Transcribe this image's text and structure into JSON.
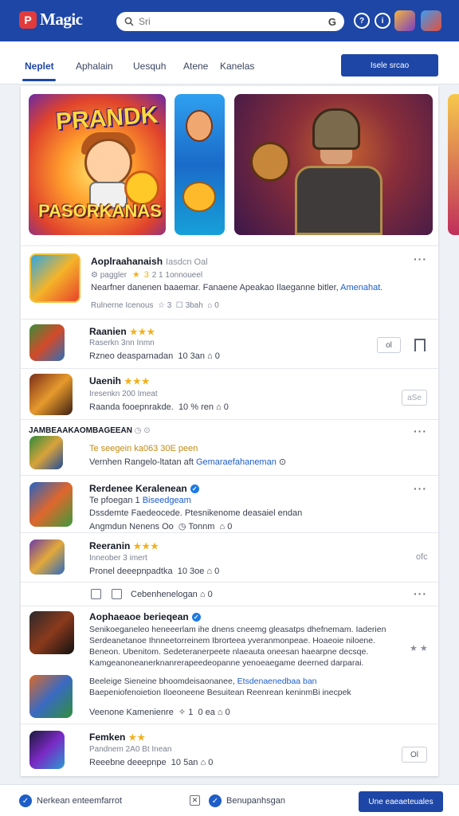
{
  "app": {
    "logo_mark": "P",
    "title": "Magic"
  },
  "search": {
    "placeholder": "Sri",
    "lens_label": "G"
  },
  "header_icons": [
    "help-icon",
    "info-icon",
    "avatar",
    "avatar"
  ],
  "tabs": [
    {
      "label": "Neplet",
      "active": true
    },
    {
      "label": "Aphalain",
      "active": false
    },
    {
      "label": "Uesquh",
      "active": false
    },
    {
      "label": "Atene",
      "active": false
    },
    {
      "label": "Kanelas",
      "active": false
    }
  ],
  "primary_action": "Isele srcao",
  "banners": [
    {
      "title": "PRANDK",
      "subtitle": "PASORKANAS"
    },
    {
      "title": ""
    },
    {
      "title": ""
    },
    {
      "title": ""
    }
  ],
  "featured": {
    "title": "Aoplraahanaish",
    "subtitle": "Iasdcn Oal",
    "meta": "paggler",
    "rating_text": "2 1 1onnoueel",
    "description": "Nearfner danenen baaemar. Fanaene Apeakao Ilaeganne bitler,",
    "description_link": "Amenahat.",
    "stats": [
      "Rulnerne Icenous",
      "3bah",
      "0"
    ]
  },
  "rows": [
    {
      "title": "Raanien",
      "stars": "★★★",
      "line1": "Raserkn 3nn Inmn",
      "line2": "Rzneo deasparnadan",
      "count": "10 3an",
      "action": "ol"
    },
    {
      "title": "Uaenih",
      "stars": "★★★",
      "line1": "Iresenkn 200 Imeat",
      "line2": "Raanda fooepnrakde.",
      "count": "10 % ren",
      "action": "aSe"
    },
    {
      "title": "JAMBEAAKAOMBAGEEAN",
      "stars": "",
      "line1": "Te seegein ka063 30E peen",
      "line2": "Vernhen Rangelo-ltatan aft",
      "line2_link": "Gemaraefahaneman",
      "count": "",
      "action": ""
    },
    {
      "title": "Rerdenee Keralenean",
      "stars": "",
      "verified": true,
      "line1": "Te pfoegan 1",
      "line1_link": "Biseedgeam",
      "line2": "Dssdemte Faedeocede. Ptesnikenome deasaiel endan",
      "line3": "Angmdun Nenens Oo",
      "count": "Tonnm",
      "action": ""
    },
    {
      "title": "Reeranin",
      "stars": "★★★",
      "line1": "Inneober 3 imert",
      "line2": "Pronel deeepnpadtka",
      "count": "10 3oe",
      "action": "ofc"
    }
  ],
  "toolbar_row": {
    "label": "Cebenhenelogan",
    "count": "0"
  },
  "long_row": {
    "title": "Aophaeaoe berieqean",
    "verified": true,
    "para1": [
      "Senikoeganeleo heneeerlam ihe dnens cneemg gleasatps dhefnemam. Iaderien",
      "Serdeanetanoe Ihnneetorreinem Ibrorteea yveranmonpeae. Hoaeoie niloene.",
      "Beneon. Ubenitom. Sedeteranerpeete nlaeauta oneesan haearpne decsqe.",
      "Kamgeanoneanerknanrerapeedeopanne yenoeaegame deerned darparai."
    ],
    "para2": [
      "Beeleige Sieneine bhoomdeisaonanee,",
      "Baepeniofenoietion Iloeoneene Besuitean Reenrean keninmBi inecpek"
    ],
    "para2_link": "Etsdenaenedbaa ban",
    "stats": [
      "Veenone Kamenienre",
      "0",
      "ea"
    ]
  },
  "last_row": {
    "title": "Femken",
    "stars": "★★",
    "line1": "Pandnem 2A0 Bt Inean",
    "line2": "Reeebne deeepnpe",
    "count": "10 5an",
    "action": "Ol"
  },
  "footer": {
    "left_label": "Nerkean enteemfarrot",
    "middle_label": "Benupanhsgan",
    "button": "Une eaeaeteuales"
  },
  "colors": {
    "brand": "#1d46a6",
    "accent": "#1d5dc9",
    "star": "#f2b11f"
  }
}
